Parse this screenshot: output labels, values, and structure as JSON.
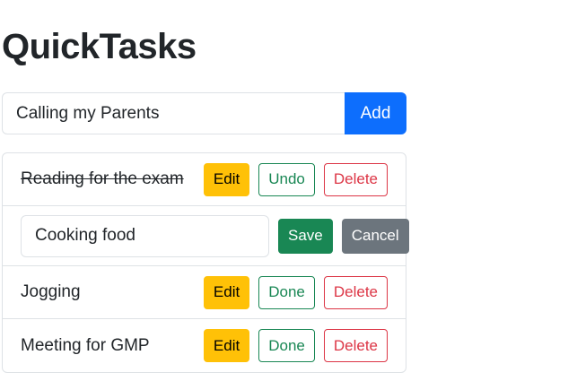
{
  "app": {
    "title": "QuickTasks"
  },
  "add_form": {
    "input_value": "Calling my Parents",
    "add_label": "Add"
  },
  "tasks": [
    {
      "text": "Reading for the exam",
      "completed": true,
      "edit_label": "Edit",
      "toggle_label": "Undo",
      "delete_label": "Delete"
    },
    {
      "editing": true,
      "edit_value": "Cooking food",
      "save_label": "Save",
      "cancel_label": "Cancel"
    },
    {
      "text": "Jogging",
      "completed": false,
      "edit_label": "Edit",
      "toggle_label": "Done",
      "delete_label": "Delete"
    },
    {
      "text": "Meeting for GMP",
      "completed": false,
      "edit_label": "Edit",
      "toggle_label": "Done",
      "delete_label": "Delete"
    }
  ],
  "colors": {
    "primary": "#0d6efd",
    "warning": "#ffc107",
    "success": "#198754",
    "danger": "#dc3545",
    "secondary": "#6c757d"
  }
}
